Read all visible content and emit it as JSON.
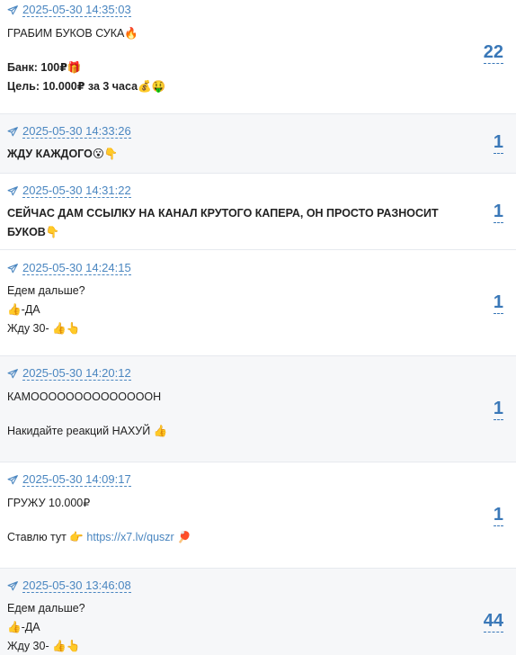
{
  "posts": [
    {
      "date": "2025-05-30 14:35:03",
      "lines": [
        "ГРАБИМ БУКОВ СУКА🔥",
        "",
        "Банк: 100₽🎁",
        "Цель: 10.000₽ за 3 часа💰🤑"
      ],
      "counter": "22"
    },
    {
      "date": "2025-05-30 14:33:26",
      "lines": [
        "ЖДУ КАЖДОГО😮👇"
      ],
      "counter": "1"
    },
    {
      "date": "2025-05-30 14:31:22",
      "lines": [
        "СЕЙЧАС ДАМ ССЫЛКУ НА КАНАЛ КРУТОГО КАПЕРА, ОН ПРОСТО РАЗНОСИТ",
        "БУКОВ👇"
      ],
      "counter": "1"
    },
    {
      "date": "2025-05-30 14:24:15",
      "lines": [
        "Едем дальше?",
        "👍-ДА",
        "Жду 30- 👍👆"
      ],
      "counter": "1"
    },
    {
      "date": "2025-05-30 14:20:12",
      "lines": [
        "КАМООООООООООООООН",
        "",
        "Накидайте реакций НАХУЙ 👍"
      ],
      "counter": "1"
    },
    {
      "date": "2025-05-30 14:09:17",
      "lines": [
        "ГРУЖУ 10.000₽",
        "",
        "Ставлю тут 👉"
      ],
      "link": "https://x7.lv/quszr",
      "link_suffix": "🏓",
      "counter": "1"
    },
    {
      "date": "2025-05-30 13:46:08",
      "lines": [
        "Едем дальше?",
        "👍-ДА",
        "Жду 30- 👍👆"
      ],
      "counter": "44"
    }
  ],
  "icons": {
    "post_date": "telegram-plane-icon"
  },
  "colors": {
    "accent": "#3a78b8",
    "alt_row": "#f6f7f9"
  }
}
